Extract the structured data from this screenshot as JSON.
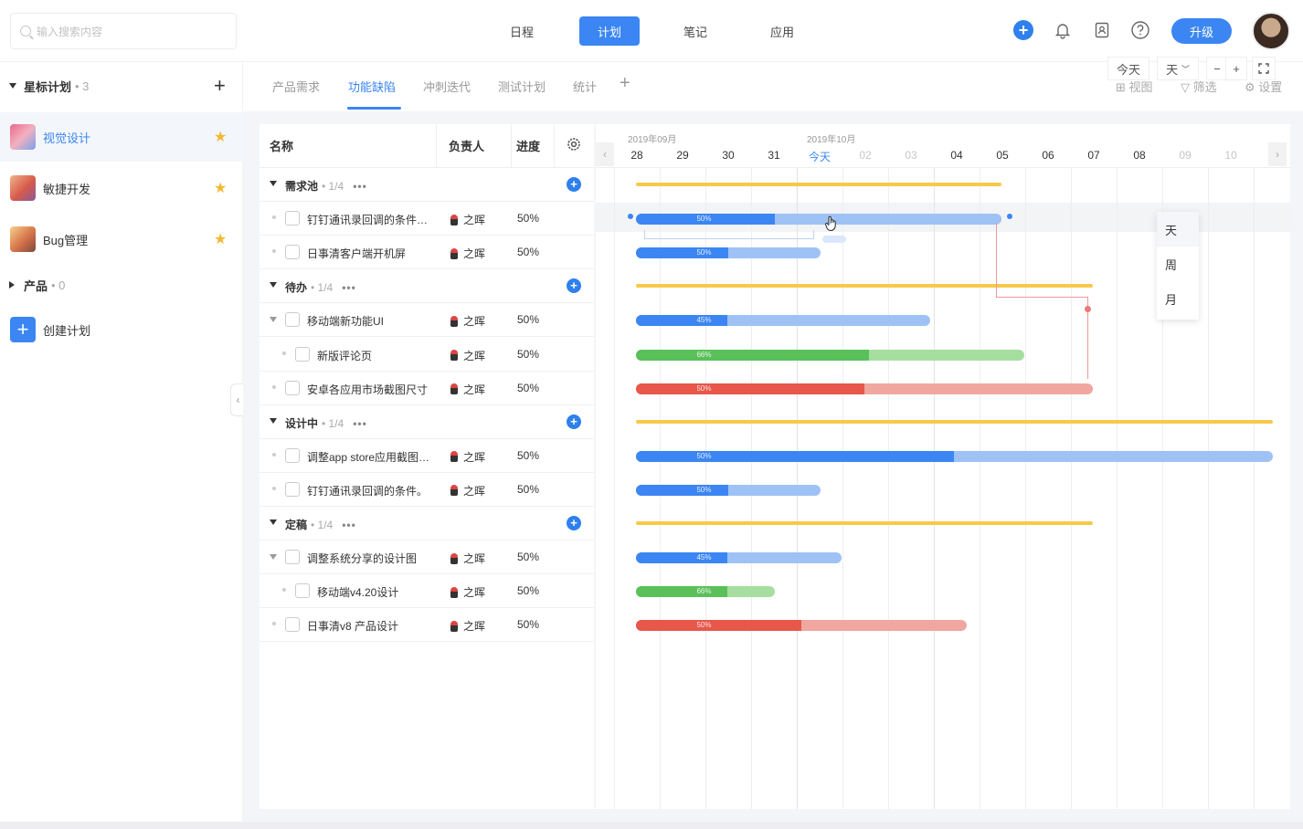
{
  "search": {
    "placeholder": "输入搜索内容"
  },
  "nav": {
    "items": [
      "日程",
      "计划",
      "笔记",
      "应用"
    ],
    "active": "计划"
  },
  "header": {
    "upgrade_label": "升级"
  },
  "sidebar": {
    "starred": {
      "label": "星标计划",
      "count": "• 3"
    },
    "items": [
      {
        "label": "视觉设计",
        "active": true
      },
      {
        "label": "敏捷开发",
        "active": false
      },
      {
        "label": "Bug管理",
        "active": false
      }
    ],
    "products": {
      "label": "产品",
      "count": "• 0"
    },
    "create_label": "创建计划"
  },
  "tabs": {
    "items": [
      "产品需求",
      "功能缺陷",
      "冲刺迭代",
      "测试计划",
      "统计"
    ],
    "active": "功能缺陷"
  },
  "toolbar": {
    "view": "视图",
    "filter": "筛选",
    "settings": "设置"
  },
  "table": {
    "headers": {
      "name": "名称",
      "owner": "负责人",
      "progress": "进度"
    },
    "groups": [
      {
        "name": "需求池",
        "count": "• 1/4",
        "tasks": [
          {
            "name": "钉钉通讯录回调的条件…",
            "owner": "之晖",
            "progress": "50%",
            "level": 0,
            "expand": false
          },
          {
            "name": "日事清客户端开机屏",
            "owner": "之晖",
            "progress": "50%",
            "level": 0,
            "expand": false
          }
        ]
      },
      {
        "name": "待办",
        "count": "• 1/4",
        "tasks": [
          {
            "name": "移动端新功能UI",
            "owner": "之晖",
            "progress": "50%",
            "level": 0,
            "expand": true
          },
          {
            "name": "新版评论页",
            "owner": "之晖",
            "progress": "50%",
            "level": 1,
            "expand": false
          },
          {
            "name": "安卓各应用市场截图尺寸",
            "owner": "之晖",
            "progress": "50%",
            "level": 0,
            "expand": false
          }
        ]
      },
      {
        "name": "设计中",
        "count": "• 1/4",
        "tasks": [
          {
            "name": "调整app store应用截图…",
            "owner": "之晖",
            "progress": "50%",
            "level": 0,
            "expand": false
          },
          {
            "name": "钉钉通讯录回调的条件。",
            "owner": "之晖",
            "progress": "50%",
            "level": 0,
            "expand": false
          }
        ]
      },
      {
        "name": "定稿",
        "count": "• 1/4",
        "tasks": [
          {
            "name": "调整系统分享的设计图",
            "owner": "之晖",
            "progress": "50%",
            "level": 0,
            "expand": true
          },
          {
            "name": "移动端v4.20设计",
            "owner": "之晖",
            "progress": "50%",
            "level": 1,
            "expand": false
          },
          {
            "name": "日事清v8 产品设计",
            "owner": "之晖",
            "progress": "50%",
            "level": 0,
            "expand": false
          }
        ]
      }
    ]
  },
  "gantt": {
    "months": [
      "2019年09月",
      "2019年10月"
    ],
    "days": [
      "28",
      "29",
      "30",
      "31",
      "今天",
      "02",
      "03",
      "04",
      "05",
      "06",
      "07",
      "08",
      "09",
      "10"
    ],
    "today_label": "今天",
    "scale_selected": "天",
    "scale_options": [
      "天",
      "周",
      "月"
    ],
    "colors": {
      "blue": "#3b86f2",
      "green": "#5ac05a",
      "red": "#e7574a",
      "yellow": "#f7c94a"
    },
    "bars": [
      {
        "row": 0,
        "type": "group"
      },
      {
        "row": 1,
        "color": "blue",
        "pct": "50%"
      },
      {
        "row": 2,
        "color": "blue",
        "pct": "50%"
      },
      {
        "row": 3,
        "type": "group"
      },
      {
        "row": 4,
        "color": "blue",
        "pct": "45%"
      },
      {
        "row": 5,
        "color": "green",
        "pct": "66%"
      },
      {
        "row": 6,
        "color": "red",
        "pct": "50%"
      },
      {
        "row": 7,
        "type": "group"
      },
      {
        "row": 8,
        "color": "blue",
        "pct": "50%"
      },
      {
        "row": 9,
        "color": "blue",
        "pct": "50%"
      },
      {
        "row": 10,
        "type": "group"
      },
      {
        "row": 11,
        "color": "blue",
        "pct": "45%"
      },
      {
        "row": 12,
        "color": "green",
        "pct": "66%"
      },
      {
        "row": 13,
        "color": "red",
        "pct": "50%"
      }
    ]
  }
}
